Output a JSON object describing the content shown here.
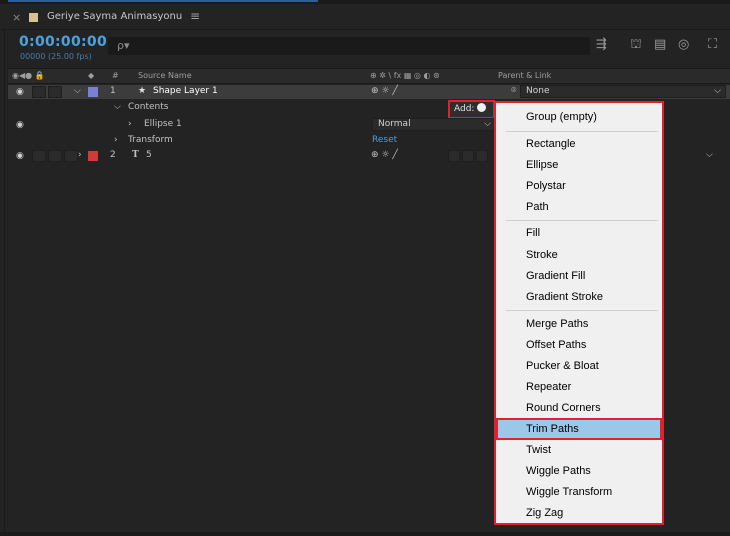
{
  "tab": {
    "close": "×",
    "title": "Geriye Sayma Animasyonu",
    "menu": "≡"
  },
  "time": {
    "timecode": "0:00:00:00",
    "frames": "00000 (25.00 fps)"
  },
  "search": {
    "icon": "ρ▾"
  },
  "toolbar": {
    "icons": [
      "⇶",
      "⛫",
      "▤",
      "◎",
      "⛶"
    ]
  },
  "header": {
    "switches_left": "◉◀● 🔒",
    "label_tag": "◆",
    "num": "#",
    "source_name": "Source Name",
    "switches_right": "⊕ ✲ \\ fx ▦ ◎ ◐ ⊛",
    "parent": "Parent & Link"
  },
  "layers": [
    {
      "num": "1",
      "star": "★",
      "name": "Shape Layer 1",
      "switch": "⊕ ☼ ╱",
      "parent_icon": "⌾",
      "parent": "None",
      "color": "#7b7fd6"
    },
    {
      "num": "2",
      "type": "T",
      "name": "5",
      "switch": "⊕ ☼ ╱",
      "color": "#d23a3a"
    }
  ],
  "contents": {
    "label": "Contents",
    "add_label": "Add:",
    "ellipse": "Ellipse 1",
    "ellipse_mode": "Normal",
    "transform": "Transform",
    "reset": "Reset"
  },
  "menu": {
    "items": [
      "Group (empty)",
      "Rectangle",
      "Ellipse",
      "Polystar",
      "Path",
      "Fill",
      "Stroke",
      "Gradient Fill",
      "Gradient Stroke",
      "Merge Paths",
      "Offset Paths",
      "Pucker & Bloat",
      "Repeater",
      "Round Corners",
      "Trim Paths",
      "Twist",
      "Wiggle Paths",
      "Wiggle Transform",
      "Zig Zag"
    ],
    "highlighted": "Trim Paths"
  },
  "colors": {
    "accent": "#4aa3df",
    "highlight_red": "#e1212c",
    "menu_highlight": "#9cc7e8"
  }
}
